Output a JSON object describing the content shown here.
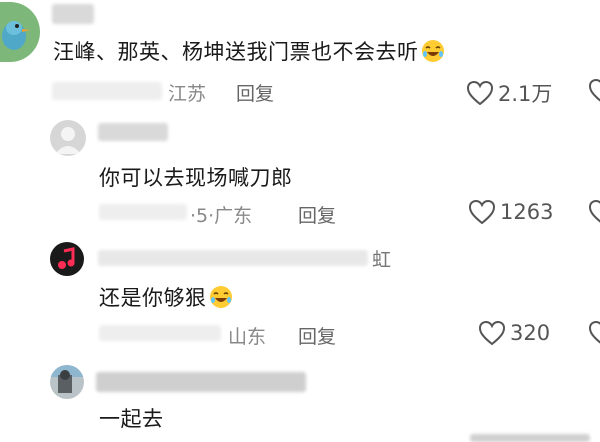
{
  "comments": [
    {
      "text": "汪峰、那英、杨坤送我门票也不会去听",
      "location": "江苏",
      "reply_label": "回复",
      "likes": "2.1万"
    },
    {
      "text": "你可以去现场喊刀郎",
      "date_location": "·5·广东",
      "reply_label": "回复",
      "likes": "1263"
    },
    {
      "username_partial": "虹",
      "text": "还是你够狠",
      "location": "山东",
      "reply_label": "回复",
      "likes": "320"
    },
    {
      "text": "一起去"
    }
  ],
  "icons": {
    "like": "heart-outline-icon",
    "laugh": "laughing-emoji-icon",
    "music": "music-note-icon"
  },
  "colors": {
    "meta_gray": "#888888",
    "heart_gray": "#555555",
    "avatar1_bg": "#7db87a",
    "avatar3_bg": "#1a1a1a",
    "music_red": "#ff2d55"
  }
}
